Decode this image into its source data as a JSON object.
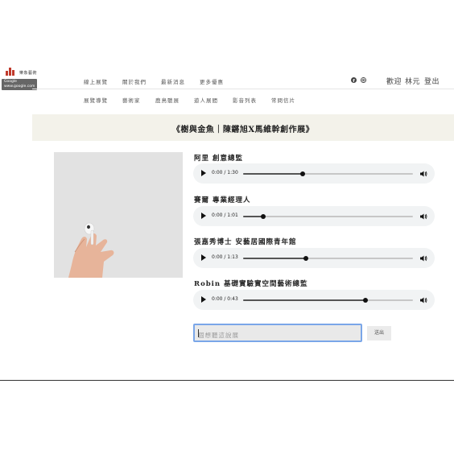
{
  "logo": {
    "text": "樂象藝術",
    "tooltip_line1": "Google",
    "tooltip_line2": "www.google.com"
  },
  "nav": {
    "row1": [
      "線上展覽",
      "關於我們",
      "最新消息",
      "更多優惠"
    ],
    "row2": [
      "展覽導覽",
      "藝術家",
      "鹿鳥聽展",
      "遊人展間",
      "影音列表",
      "常問信片"
    ]
  },
  "user": {
    "welcome": "歡迎",
    "name": "林元",
    "logout": "登出"
  },
  "banner": {
    "title": "《樹與金魚｜陳鏘旭X馬維幹創作展》"
  },
  "audio_items": [
    {
      "speaker": "阿里 創意總監",
      "time": "0:00 / 1:30",
      "progress": 0.35
    },
    {
      "speaker": "賽爾 專業經理人",
      "time": "0:00 / 1:01",
      "progress": 0.12
    },
    {
      "speaker": "張嘉秀博士 安藝居國際青年館",
      "time": "0:00 / 1:13",
      "progress": 0.37
    },
    {
      "speaker": "Robin 基礎實驗實空間藝術總監",
      "time": "0:00 / 0:43",
      "progress": 0.72
    }
  ],
  "comment": {
    "placeholder": "個想聽這說展",
    "value": ""
  },
  "send_label": "送出",
  "icons": {
    "social1": "facebook-icon",
    "social2": "instagram-icon",
    "play": "play-icon",
    "volume": "volume-icon"
  },
  "colors": {
    "banner_bg": "#f3f2ea",
    "input_focus": "#7aa6e8",
    "logo_red": "#c0392b"
  }
}
